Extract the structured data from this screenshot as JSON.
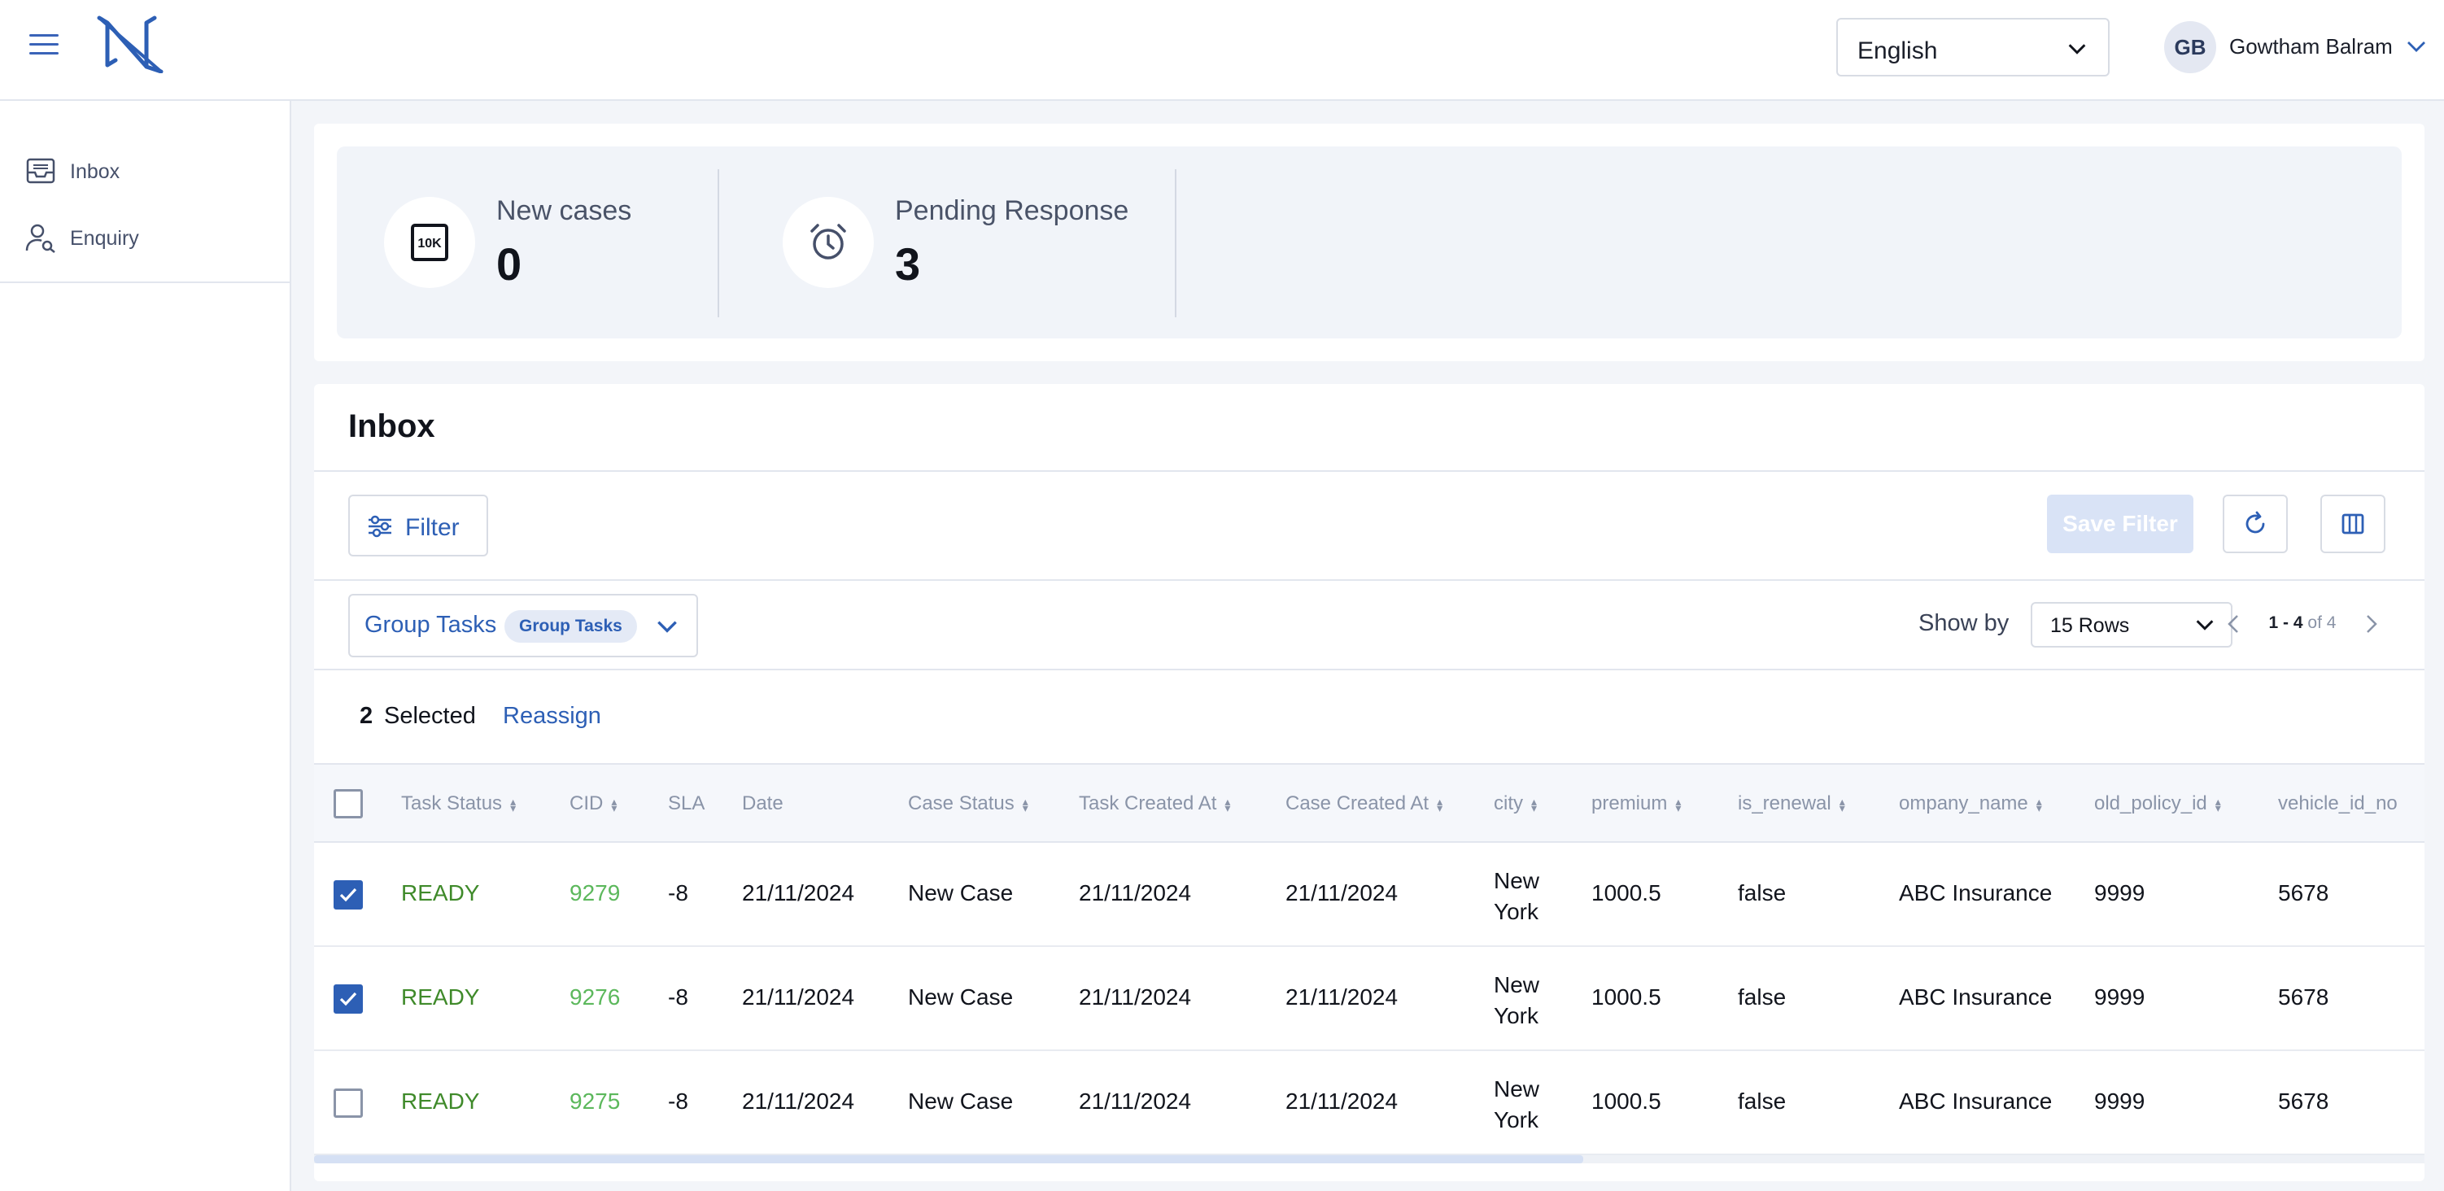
{
  "header": {
    "language": "English",
    "user": {
      "initials": "GB",
      "name": "Gowtham Balram"
    }
  },
  "sidebar": {
    "items": [
      {
        "label": "Inbox",
        "icon": "inbox-tray-icon"
      },
      {
        "label": "Enquiry",
        "icon": "user-search-icon"
      }
    ]
  },
  "stats": [
    {
      "title": "New cases",
      "value": "0",
      "icon": "10k-icon"
    },
    {
      "title": "Pending Response",
      "value": "3",
      "icon": "alarm-clock-icon"
    }
  ],
  "inbox": {
    "title": "Inbox",
    "filter_label": "Filter",
    "save_filter_label": "Save Filter",
    "group": {
      "label": "Group Tasks",
      "chip": "Group Tasks"
    },
    "show_by_label": "Show by",
    "rows_option": "15 Rows",
    "pager": {
      "range": "1 - 4",
      "of": "of 4"
    },
    "selection": {
      "count": "2",
      "label": "Selected",
      "action": "Reassign"
    },
    "columns": [
      "Task Status",
      "CID",
      "SLA",
      "Date",
      "Case Status",
      "Task Created At",
      "Case Created At",
      "city",
      "premium",
      "is_renewal",
      "ompany_name",
      "old_policy_id",
      "vehicle_id_no"
    ],
    "rows": [
      {
        "checked": true,
        "task_status": "READY",
        "cid": "9279",
        "sla": "-8",
        "date": "21/11/2024",
        "case_status": "New Case",
        "task_created": "21/11/2024",
        "case_created": "21/11/2024",
        "city": "New York",
        "premium": "1000.5",
        "is_renewal": "false",
        "company": "ABC Insurance",
        "old_policy": "9999",
        "vehicle": "5678"
      },
      {
        "checked": true,
        "task_status": "READY",
        "cid": "9276",
        "sla": "-8",
        "date": "21/11/2024",
        "case_status": "New Case",
        "task_created": "21/11/2024",
        "case_created": "21/11/2024",
        "city": "New York",
        "premium": "1000.5",
        "is_renewal": "false",
        "company": "ABC Insurance",
        "old_policy": "9999",
        "vehicle": "5678"
      },
      {
        "checked": false,
        "task_status": "READY",
        "cid": "9275",
        "sla": "-8",
        "date": "21/11/2024",
        "case_status": "New Case",
        "task_created": "21/11/2024",
        "case_created": "21/11/2024",
        "city": "New York",
        "premium": "1000.5",
        "is_renewal": "false",
        "company": "ABC Insurance",
        "old_policy": "9999",
        "vehicle": "5678"
      }
    ]
  },
  "colors": {
    "brand": "#2d5fb5",
    "ready": "#3f8a2a",
    "cid": "#5cb85c"
  }
}
